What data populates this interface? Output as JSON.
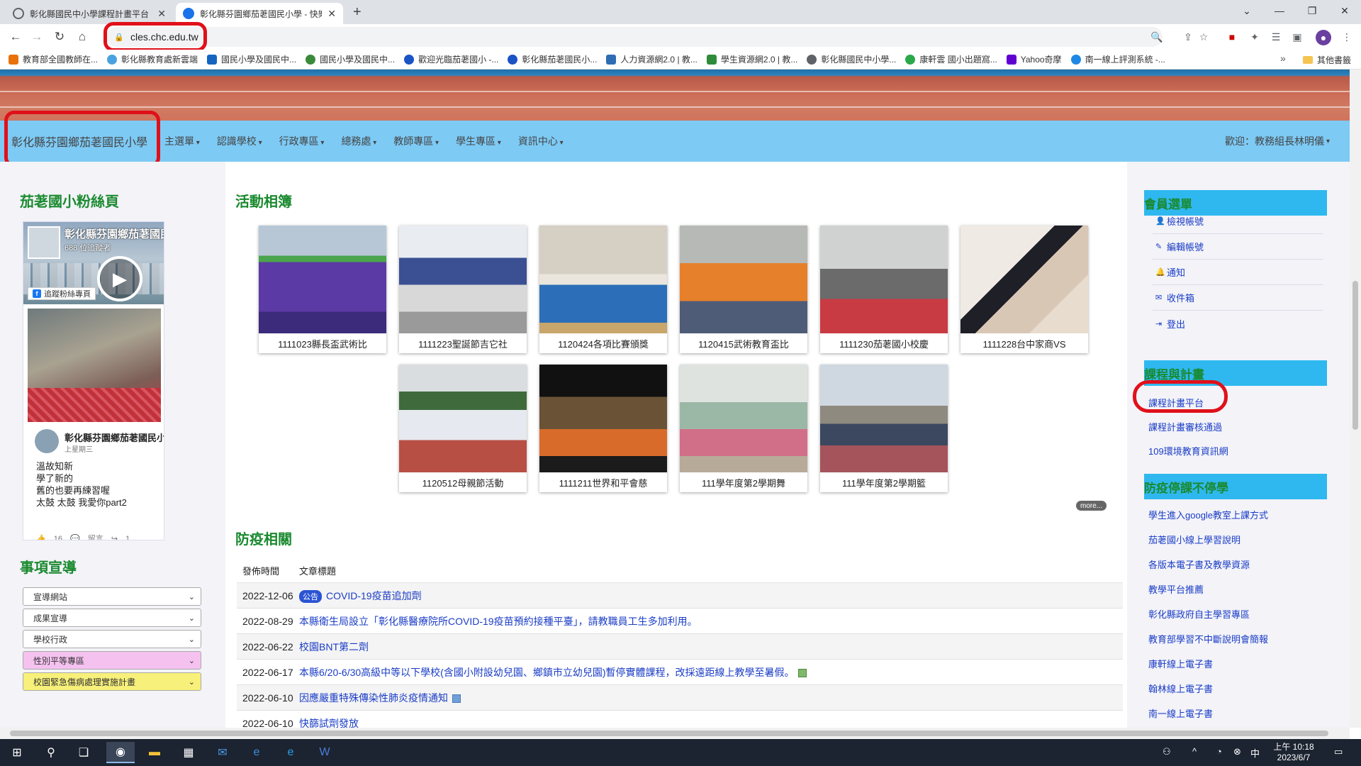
{
  "browser": {
    "tabs": [
      {
        "title": "彰化縣國民中小學課程計畫平台",
        "active": false
      },
      {
        "title": "彰化縣芬園鄉茄荖國民小學 - 快樂",
        "active": true
      }
    ],
    "url": "cles.chc.edu.tw",
    "bookmarks": [
      "教育部全國教師在...",
      "彰化縣教育處新雲端",
      "國民小學及國民中...",
      "國民小學及國民中...",
      "歡迎光臨茄荖國小 -...",
      "彰化縣茄荖國民小...",
      "人力資源網2.0 | 教...",
      "學生資源網2.0 | 教...",
      "彰化縣國民中小學...",
      "康軒雲 國小出題窩...",
      "Yahoo奇摩",
      "南一線上評測系統 -..."
    ],
    "bookmarks_other": "其他書籤",
    "bookmarks_more": "»"
  },
  "site": {
    "brand": "彰化縣芬園鄉茄荖國民小學",
    "menu": [
      "主選單",
      "認識學校",
      "行政專區",
      "總務處",
      "教師專區",
      "學生專區",
      "資訊中心"
    ],
    "welcome": "歡迎：教務組長林明儀"
  },
  "left": {
    "fans_title": "茄荖國小粉絲頁",
    "fb": {
      "page_name": "彰化縣芬園鄉茄荖國民小學",
      "followers": "688 位追蹤者",
      "follow_btn": "追蹤粉絲專頁",
      "post_name": "彰化縣芬園鄉茄荖國民小學",
      "post_time": "上星期三",
      "post_lines": [
        "溫故知新",
        "學了新的",
        "舊的也要再練習喔",
        "太鼓 太鼓 我愛你part2"
      ],
      "stats": "👍 16 💬 留言 ↪ 1"
    },
    "promo_title": "事項宣導",
    "selects": [
      {
        "label": "宣導網站",
        "color": "#ffffff"
      },
      {
        "label": "成果宣導",
        "color": "#ffffff"
      },
      {
        "label": "學校行政",
        "color": "#ffffff"
      },
      {
        "label": "性別平等專區",
        "color": "#f5c2f0"
      },
      {
        "label": "校園緊急傷病處理實施計畫",
        "color": "#f7f07a"
      }
    ]
  },
  "album": {
    "title": "活動相簿",
    "items": [
      {
        "caption": "1111023縣長盃武術比",
        "tone": "purple"
      },
      {
        "caption": "1111223聖誕節吉它社",
        "tone": "hall"
      },
      {
        "caption": "1120424各項比賽頒獎",
        "tone": "school"
      },
      {
        "caption": "1120415武術教育盃比",
        "tone": "orange"
      },
      {
        "caption": "1111230茄荖國小校慶",
        "tone": "ceremony"
      },
      {
        "caption": "1111228台中家商VS",
        "tone": "girl"
      },
      {
        "caption": "1120512母親節活動",
        "tone": "track"
      },
      {
        "caption": "1111211世界和平會慈",
        "tone": "stage"
      },
      {
        "caption": "111學年度第2學期舞",
        "tone": "classroom"
      },
      {
        "caption": "111學年度第2學期籃",
        "tone": "court"
      }
    ],
    "more": "more..."
  },
  "epidemic": {
    "title": "防疫相關",
    "col_date": "發佈時間",
    "col_title": "文章標題",
    "rows": [
      {
        "date": "2022-12-06",
        "badge": "公告",
        "title": "COVID-19疫苗追加劑",
        "icon": false
      },
      {
        "date": "2022-08-29",
        "badge": "",
        "title": "本縣衛生局設立「彰化縣醫療院所COVID-19疫苗預約接種平臺」，請教職員工生多加利用。",
        "icon": false
      },
      {
        "date": "2022-06-22",
        "badge": "",
        "title": "校園BNT第二劑",
        "icon": false
      },
      {
        "date": "2022-06-17",
        "badge": "",
        "title": "本縣6/20-6/30高級中等以下學校(含國小附設幼兒園、鄉鎮市立幼兒園)暫停實體課程，改採遠距線上教學至暑假。",
        "icon": true
      },
      {
        "date": "2022-06-10",
        "badge": "",
        "title": "因應嚴重特殊傳染性肺炎疫情通知",
        "icon": true
      },
      {
        "date": "2022-06-10",
        "badge": "",
        "title": "快篩試劑發放",
        "icon": false
      }
    ]
  },
  "right": {
    "member_title": "會員選單",
    "member_items": [
      {
        "icon": "user-icon",
        "glyph": "👤",
        "label": "檢視帳號"
      },
      {
        "icon": "edit-icon",
        "glyph": "✎",
        "label": "編輯帳號"
      },
      {
        "icon": "bell-icon",
        "glyph": "🔔",
        "label": "通知"
      },
      {
        "icon": "envelope-icon",
        "glyph": "✉",
        "label": "收件箱"
      },
      {
        "icon": "logout-icon",
        "glyph": "⇥",
        "label": "登出"
      }
    ],
    "course_title": "課程與計畫",
    "course_links": [
      "課程計畫平台",
      "課程計畫審核通過",
      "109環境教育資訊網"
    ],
    "covid_title": "防疫停課不停學",
    "covid_links": [
      "學生進入google教室上課方式",
      "茄荖國小線上學習說明",
      "各版本電子書及教學資源",
      "教學平台推薦",
      "彰化縣政府自主學習專區",
      "教育部學習不中斷說明會簡報",
      "康軒線上電子書",
      "翰林線上電子書",
      "南一線上電子書"
    ]
  },
  "taskbar": {
    "time": "上午 10:18",
    "date": "2023/6/7"
  }
}
